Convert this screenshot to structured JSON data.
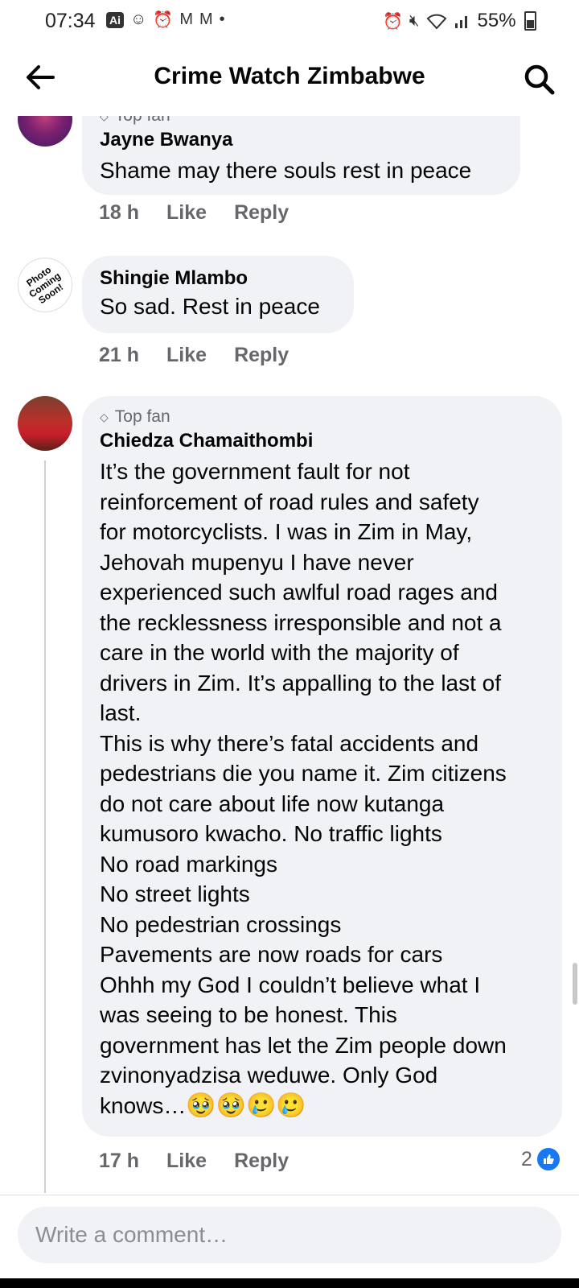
{
  "status_bar": {
    "time": "07:34",
    "ai_badge": "Ai",
    "battery": "55%"
  },
  "header": {
    "title": "Crime Watch Zimbabwe"
  },
  "comments": [
    {
      "badge": "Top fan",
      "name": "Jayne Bwanya",
      "text": "Shame may there souls rest in peace",
      "time": "18 h",
      "like": "Like",
      "reply": "Reply"
    },
    {
      "name": "Shingie Mlambo",
      "avatar_text": "Photo Coming Soon!",
      "text": "So sad. Rest in peace",
      "time": "21 h",
      "like": "Like",
      "reply": "Reply"
    },
    {
      "badge": "Top fan",
      "name": "Chiedza Chamaithombi",
      "text": "It’s the government fault for not\nreinforcement of road rules and safety\nfor motorcyclists. I was in Zim in May,\nJehovah mupenyu I have never\nexperienced such awlful road rages and\nthe recklessness irresponsible and not a\ncare in the world with the majority of\ndrivers in Zim. It’s appalling to the last of\nlast.\nThis is why there’s fatal accidents and\npedestrians die you name it. Zim citizens\ndo not care about life now kutanga\nkumusoro kwacho. No traffic lights\nNo road markings\nNo street lights\nNo pedestrian crossings\nPavements are now roads for cars\nOhhh my God I couldn’t believe what I\nwas seeing to be honest. This\ngovernment has let the Zim people down\nzvinonyadzisa weduwe. Only God\nknows…",
      "emojis": "🥹🥹🥲🥲",
      "time": "17 h",
      "like": "Like",
      "reply": "Reply",
      "reaction_count": "2"
    }
  ],
  "composer": {
    "placeholder": "Write a comment…"
  },
  "colors": {
    "accent": "#1877f2",
    "bubble": "#f0f2f5",
    "secondary_text": "#65676b"
  }
}
